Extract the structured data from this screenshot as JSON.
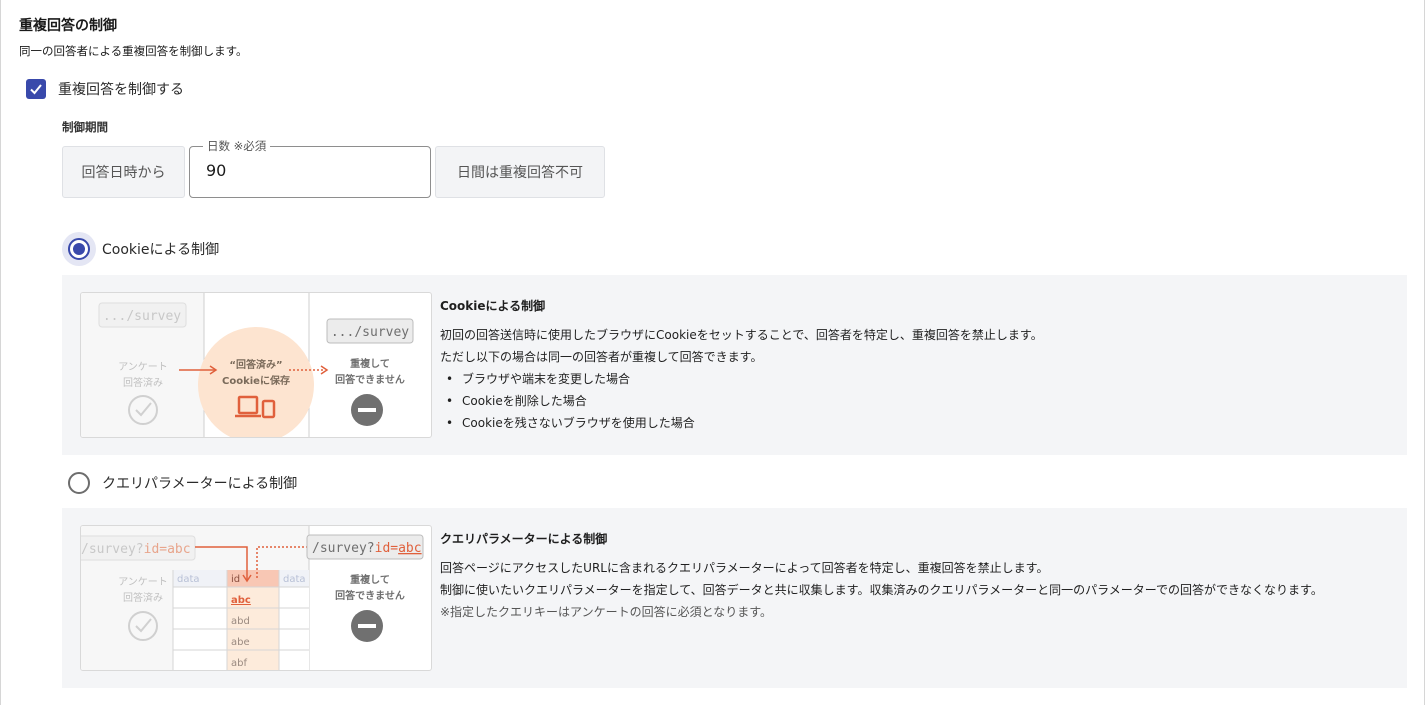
{
  "section": {
    "title": "重複回答の制御",
    "description": "同一の回答者による重複回答を制御します。"
  },
  "duplicate_control": {
    "checkbox_label": "重複回答を制御する",
    "checked": true
  },
  "period": {
    "label": "制御期間",
    "prefix": "回答日時から",
    "days_legend": "日数 ※必須",
    "days_value": "90",
    "suffix": "日間は重複回答不可"
  },
  "options": {
    "cookie": {
      "radio_label": "Cookieによる制御",
      "selected": true,
      "info_title": "Cookieによる制御",
      "info_lines": [
        "初回の回答送信時に使用したブラウザにCookieをセットすることで、回答者を特定し、重複回答を禁止します。",
        "ただし以下の場合は同一の回答者が重複して回答できます。"
      ],
      "bullets": [
        "ブラウザや端末を変更した場合",
        "Cookieを削除した場合",
        "Cookieを残さないブラウザを使用した場合"
      ],
      "illus": {
        "url": ".../survey",
        "answered_1": "アンケート",
        "answered_2": "回答済み",
        "saved_1": "“回答済み”",
        "saved_2": "Cookieに保存",
        "blocked_1": "重複して",
        "blocked_2": "回答できません"
      }
    },
    "query": {
      "radio_label": "クエリパラメーターによる制御",
      "selected": false,
      "info_title": "クエリパラメーターによる制御",
      "info_lines": [
        "回答ページにアクセスしたURLに含まれるクエリパラメーターによって回答者を特定し、重複回答を禁止します。",
        "制御に使いたいクエリパラメーターを指定して、回答データと共に収集します。収集済みのクエリパラメーターと同一のパラメーターでの回答ができなくなります。"
      ],
      "note": "※指定したクエリキーはアンケートの回答に必須となります。",
      "illus": {
        "url_left_base": "/survey?",
        "url_left_param": "id=abc",
        "url_right_base": "/survey?",
        "url_right_key": "id=",
        "url_right_val": "abc",
        "answered_1": "アンケート",
        "answered_2": "回答済み",
        "col_data": "data",
        "col_id": "id",
        "ids": [
          "abc",
          "abd",
          "abe",
          "abf"
        ],
        "blocked_1": "重複して",
        "blocked_2": "回答できません"
      }
    }
  },
  "colors": {
    "accent": "#3949ab",
    "highlight": "#e0603c",
    "peach": "#fde4d0",
    "panel": "#f4f5f7"
  }
}
